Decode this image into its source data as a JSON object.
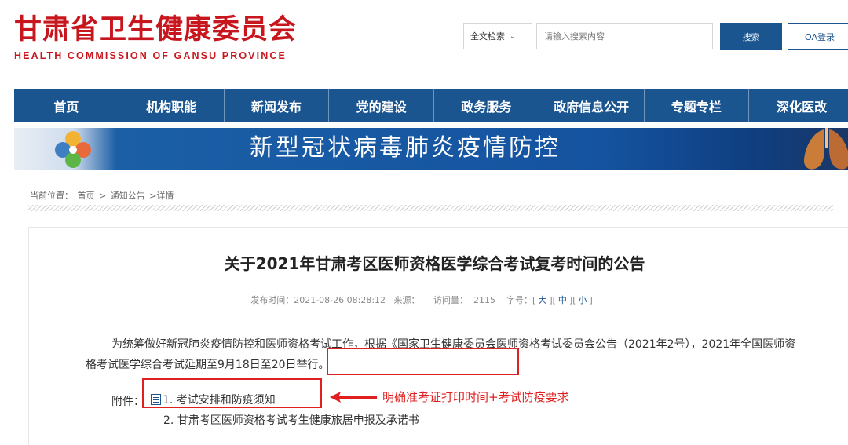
{
  "header": {
    "logo_cn": "甘肃省卫生健康委员会",
    "logo_en": "HEALTH COMMISSION OF GANSU PROVINCE",
    "search_scope": "全文检索",
    "search_placeholder": "请输入搜索内容",
    "search_button": "搜索",
    "oa_button": "OA登录"
  },
  "nav": {
    "items": [
      "首页",
      "机构职能",
      "新闻发布",
      "党的建设",
      "政务服务",
      "政府信息公开",
      "专题专栏",
      "深化医改"
    ]
  },
  "banner": {
    "text": "新型冠状病毒肺炎疫情防控"
  },
  "breadcrumb": {
    "label": "当前位置：",
    "home": "首页",
    "sep1": ">",
    "section": "通知公告",
    "current": ">详情"
  },
  "article": {
    "title": "关于2021年甘肃考区医师资格医学综合考试复考时间的公告",
    "publish_label": "发布时间：",
    "publish_time": "2021-08-26 08:28:12",
    "source_label": "来源：",
    "views_label": "访问量：",
    "views": "2115",
    "fontsize_label": "字号：",
    "size_large": "大",
    "size_medium": "中",
    "size_small": "小",
    "paragraph": "为统筹做好新冠肺炎疫情防控和医师资格考试工作，根据《国家卫生健康委员会医师资格考试委员会公告（2021年2号），2021年全国医师资格考试医学综合考试延期至9月18日至20日举行。",
    "attach_label": "附件：",
    "attachments": [
      "1. 考试安排和防疫须知",
      "2. 甘肃考区医师资格考试考生健康旅居申报及承诺书"
    ]
  },
  "annotation": {
    "text": "明确准考证打印时间+考试防疫要求",
    "color": "#e02020"
  },
  "colors": {
    "brand_red": "#c8161e",
    "nav_blue": "#1a5590"
  }
}
